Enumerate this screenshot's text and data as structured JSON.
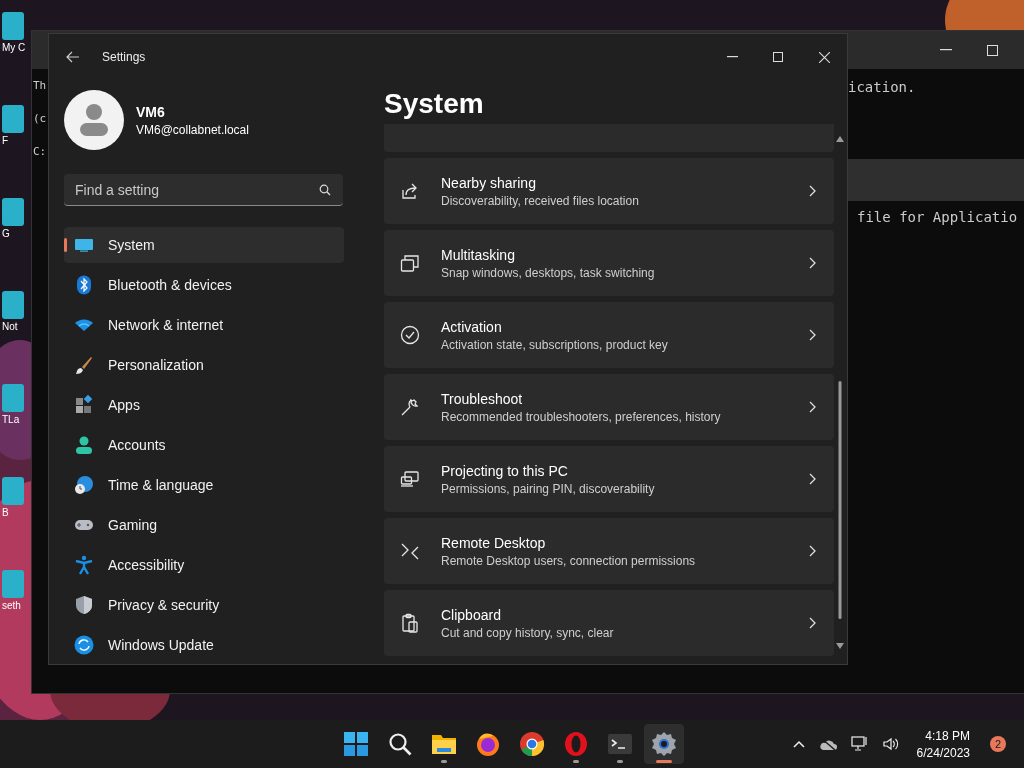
{
  "desktop": {
    "icons": [
      {
        "label": "My C"
      },
      {
        "label": "F"
      },
      {
        "label": "G"
      },
      {
        "label": "Not"
      },
      {
        "label": "TLa"
      },
      {
        "label": "B"
      },
      {
        "label": "seth"
      }
    ]
  },
  "terminal": {
    "left_fragments": [
      "Th",
      "(c",
      "C:"
    ],
    "right_fragments": [
      "ication.",
      "file for Applicatio"
    ]
  },
  "settings": {
    "title": "Settings",
    "user": {
      "name": "VM6",
      "email": "VM6@collabnet.local"
    },
    "search": {
      "placeholder": "Find a setting"
    },
    "nav": [
      {
        "label": "System",
        "kind": "system",
        "selected": true
      },
      {
        "label": "Bluetooth & devices",
        "kind": "bluetooth",
        "selected": false
      },
      {
        "label": "Network & internet",
        "kind": "network",
        "selected": false
      },
      {
        "label": "Personalization",
        "kind": "brush",
        "selected": false
      },
      {
        "label": "Apps",
        "kind": "apps",
        "selected": false
      },
      {
        "label": "Accounts",
        "kind": "accounts",
        "selected": false
      },
      {
        "label": "Time & language",
        "kind": "time",
        "selected": false
      },
      {
        "label": "Gaming",
        "kind": "gaming",
        "selected": false
      },
      {
        "label": "Accessibility",
        "kind": "accessibility",
        "selected": false
      },
      {
        "label": "Privacy & security",
        "kind": "privacy",
        "selected": false
      },
      {
        "label": "Windows Update",
        "kind": "update",
        "selected": false
      }
    ],
    "page_title": "System",
    "cards": [
      {
        "title": "Nearby sharing",
        "description": "Discoverability, received files location",
        "kind": "share"
      },
      {
        "title": "Multitasking",
        "description": "Snap windows, desktops, task switching",
        "kind": "multitasking"
      },
      {
        "title": "Activation",
        "description": "Activation state, subscriptions, product key",
        "kind": "activation"
      },
      {
        "title": "Troubleshoot",
        "description": "Recommended troubleshooters, preferences, history",
        "kind": "wrench"
      },
      {
        "title": "Projecting to this PC",
        "description": "Permissions, pairing PIN, discoverability",
        "kind": "projecting"
      },
      {
        "title": "Remote Desktop",
        "description": "Remote Desktop users, connection permissions",
        "kind": "remote"
      },
      {
        "title": "Clipboard",
        "description": "Cut and copy history, sync, clear",
        "kind": "clipboard"
      }
    ]
  },
  "taskbar": {
    "apps": [
      {
        "kind": "start",
        "running": false,
        "active": false
      },
      {
        "kind": "search",
        "running": false,
        "active": false
      },
      {
        "kind": "explorer",
        "running": true,
        "active": false
      },
      {
        "kind": "firefox",
        "running": false,
        "active": false
      },
      {
        "kind": "chrome",
        "running": false,
        "active": false
      },
      {
        "kind": "opera",
        "running": true,
        "active": false
      },
      {
        "kind": "terminal",
        "running": true,
        "active": false
      },
      {
        "kind": "settings",
        "running": true,
        "active": true
      }
    ],
    "time": "4:18 PM",
    "date": "6/24/2023",
    "notification_count": "2"
  }
}
